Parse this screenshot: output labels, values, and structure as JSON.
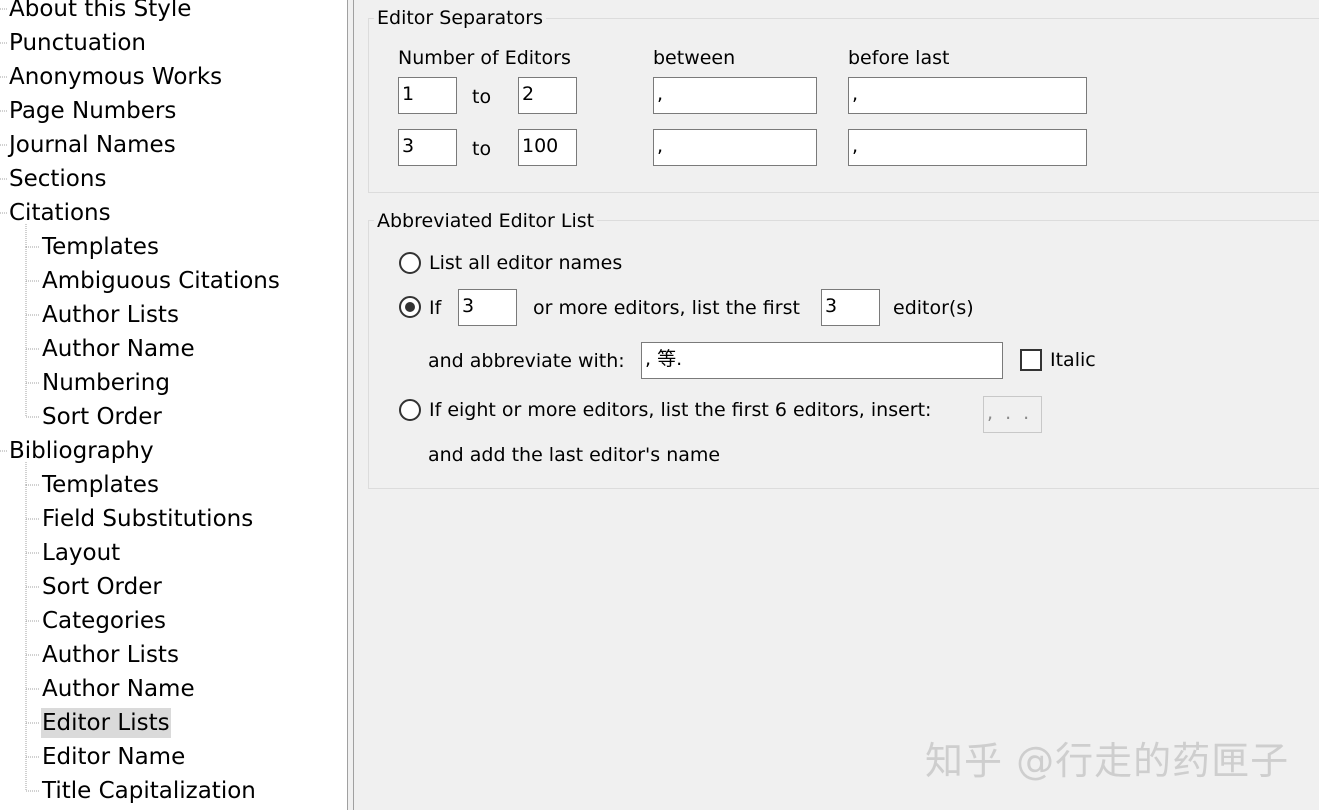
{
  "tree": {
    "items": [
      {
        "label": "About this Style",
        "level": 0
      },
      {
        "label": "Punctuation",
        "level": 0
      },
      {
        "label": "Anonymous Works",
        "level": 0
      },
      {
        "label": "Page Numbers",
        "level": 0
      },
      {
        "label": "Journal Names",
        "level": 0
      },
      {
        "label": "Sections",
        "level": 0
      },
      {
        "label": "Citations",
        "level": 0
      },
      {
        "label": "Templates",
        "level": 1
      },
      {
        "label": "Ambiguous Citations",
        "level": 1
      },
      {
        "label": "Author Lists",
        "level": 1
      },
      {
        "label": "Author Name",
        "level": 1
      },
      {
        "label": "Numbering",
        "level": 1
      },
      {
        "label": "Sort Order",
        "level": 1
      },
      {
        "label": "Bibliography",
        "level": 0
      },
      {
        "label": "Templates",
        "level": 1
      },
      {
        "label": "Field Substitutions",
        "level": 1
      },
      {
        "label": "Layout",
        "level": 1
      },
      {
        "label": "Sort Order",
        "level": 1
      },
      {
        "label": "Categories",
        "level": 1
      },
      {
        "label": "Author Lists",
        "level": 1
      },
      {
        "label": "Author Name",
        "level": 1
      },
      {
        "label": "Editor Lists",
        "level": 1,
        "selected": true
      },
      {
        "label": "Editor Name",
        "level": 1
      },
      {
        "label": "Title Capitalization",
        "level": 1
      }
    ]
  },
  "separators": {
    "title": "Editor Separators",
    "col_number": "Number of Editors",
    "col_between": "between",
    "col_before_last": "before last",
    "to_label": "to",
    "rows": [
      {
        "from": "1",
        "to": "2",
        "between": ",",
        "before_last": ","
      },
      {
        "from": "3",
        "to": "100",
        "between": ",",
        "before_last": ","
      }
    ]
  },
  "abbrev": {
    "title": "Abbreviated Editor List",
    "option1_label": "List all editor names",
    "option2_if": "If",
    "option2_count": "3",
    "option2_mid": "or more editors, list the first",
    "option2_first": "3",
    "option2_suffix": "editor(s)",
    "abbreviate_label": "and abbreviate with:",
    "abbreviate_value": ", 等.",
    "italic_label": "Italic",
    "italic_checked": false,
    "option3_label": "If eight or more editors, list the first 6 editors, insert:",
    "option3_insert": ", . . .",
    "option3_tail": "and add the last editor's name",
    "selected_option": 2
  },
  "watermark": "知乎 @行走的药匣子"
}
